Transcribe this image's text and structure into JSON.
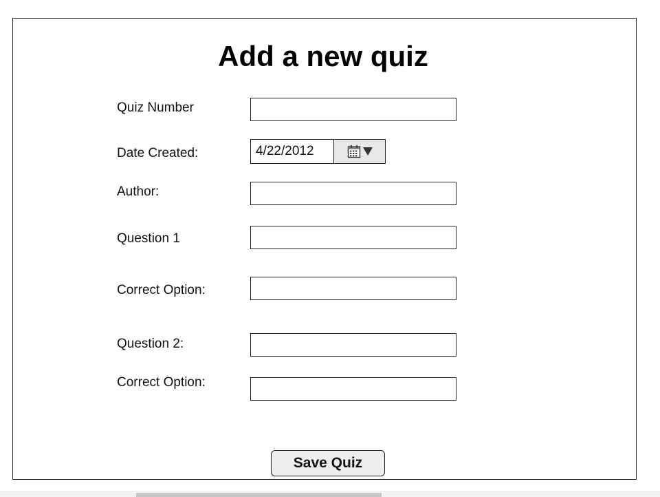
{
  "form": {
    "title": "Add a new quiz",
    "fields": {
      "quiz_number": {
        "label": "Quiz Number",
        "value": ""
      },
      "date_created": {
        "label": "Date Created:",
        "value": "4/22/2012"
      },
      "author": {
        "label": "Author:",
        "value": ""
      },
      "question_1": {
        "label": "Question 1",
        "value": ""
      },
      "correct_option_1": {
        "label": "Correct Option:",
        "value": ""
      },
      "question_2": {
        "label": "Question 2:",
        "value": ""
      },
      "correct_option_2": {
        "label": "Correct Option:",
        "value": ""
      }
    },
    "save_label": "Save Quiz"
  },
  "icons": {
    "date_picker": "calendar-icon",
    "date_dropdown": "caret-down-icon"
  },
  "colors": {
    "border": "#222222",
    "button_bg": "#eeeeee",
    "picker_button_bg": "#e8e8e8"
  }
}
